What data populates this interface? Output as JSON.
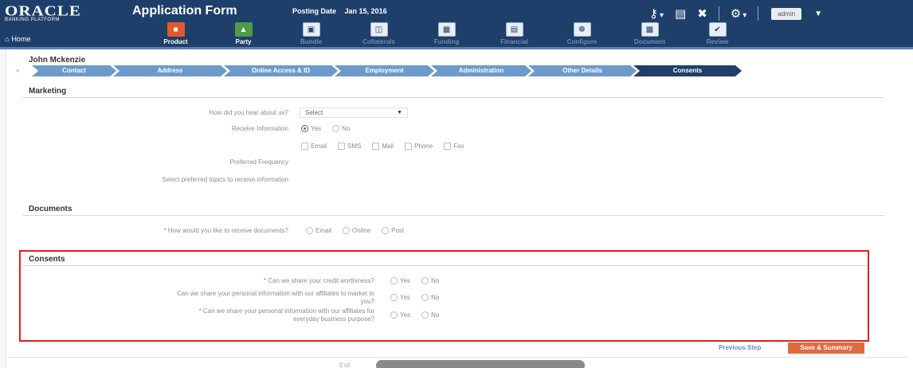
{
  "header": {
    "logo_main": "ORACLE",
    "logo_sub": "BANKING PLATFORM",
    "home_label": "Home",
    "title": "Application Form",
    "posting_date_label": "Posting Date",
    "posting_date_value": "Jan 15, 2016",
    "steps": [
      {
        "label": "Product",
        "icon": "briefcase-icon"
      },
      {
        "label": "Party",
        "icon": "person-icon"
      },
      {
        "label": "Bundle",
        "icon": "bundle-icon"
      },
      {
        "label": "Collaterals",
        "icon": "collateral-icon"
      },
      {
        "label": "Funding",
        "icon": "funding-icon"
      },
      {
        "label": "Financial",
        "icon": "financial-icon"
      },
      {
        "label": "Configure",
        "icon": "configure-icon"
      },
      {
        "label": "Document",
        "icon": "document-icon"
      },
      {
        "label": "Review",
        "icon": "review-icon"
      }
    ],
    "user": "admin"
  },
  "customer_name": "John Mckenzie",
  "breadcrumb": [
    "Contact",
    "Address",
    "Online Access & ID",
    "Employment",
    "Administration",
    "Other Details",
    "Consents"
  ],
  "marketing": {
    "title": "Marketing",
    "hear_label": "How did you hear about us?",
    "hear_value": "Select",
    "receive_label": "Receive Information",
    "receive_options": [
      "Yes",
      "No"
    ],
    "channels": [
      "Email",
      "SMS",
      "Mail",
      "Phone",
      "Fax"
    ],
    "frequency_label": "Preferred Frequency",
    "topics_label": "Select preferred topics to receive information"
  },
  "documents": {
    "title": "Documents",
    "question": "* How would you like to receive documents?",
    "options": [
      "Email",
      "Online",
      "Post"
    ]
  },
  "consents": {
    "title": "Consents",
    "q1": "* Can we share your credit worthiness?",
    "q2_line1": "Can we share your personal information with our affiliates to market to",
    "q2_line2": "you?",
    "q3_line1": "* Can we share your personal information with our affiliates for",
    "q3_line2": "everyday business purpose?",
    "yes": "Yes",
    "no": "No"
  },
  "footer": {
    "previous_step": "Previous Step",
    "save_summary": "Save & Summary",
    "text": "Exit"
  },
  "colors": {
    "header": "#1f3f6b",
    "accent": "#e06a3f",
    "highlight": "#e41e1e"
  }
}
